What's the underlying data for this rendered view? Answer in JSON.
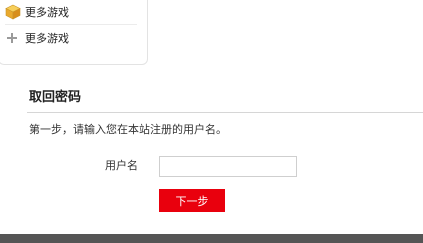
{
  "sidebar": {
    "items": [
      {
        "label": "更多游戏",
        "icon": "game-box-icon"
      },
      {
        "label": "更多游戏",
        "icon": "plus-icon"
      }
    ]
  },
  "recover": {
    "title": "取回密码",
    "step_text": "第一步，请输入您在本站注册的用户名。",
    "username_label": "用户名",
    "username_value": "",
    "next_button": "下一步"
  },
  "colors": {
    "accent": "#e9000d",
    "footer": "#555555"
  }
}
